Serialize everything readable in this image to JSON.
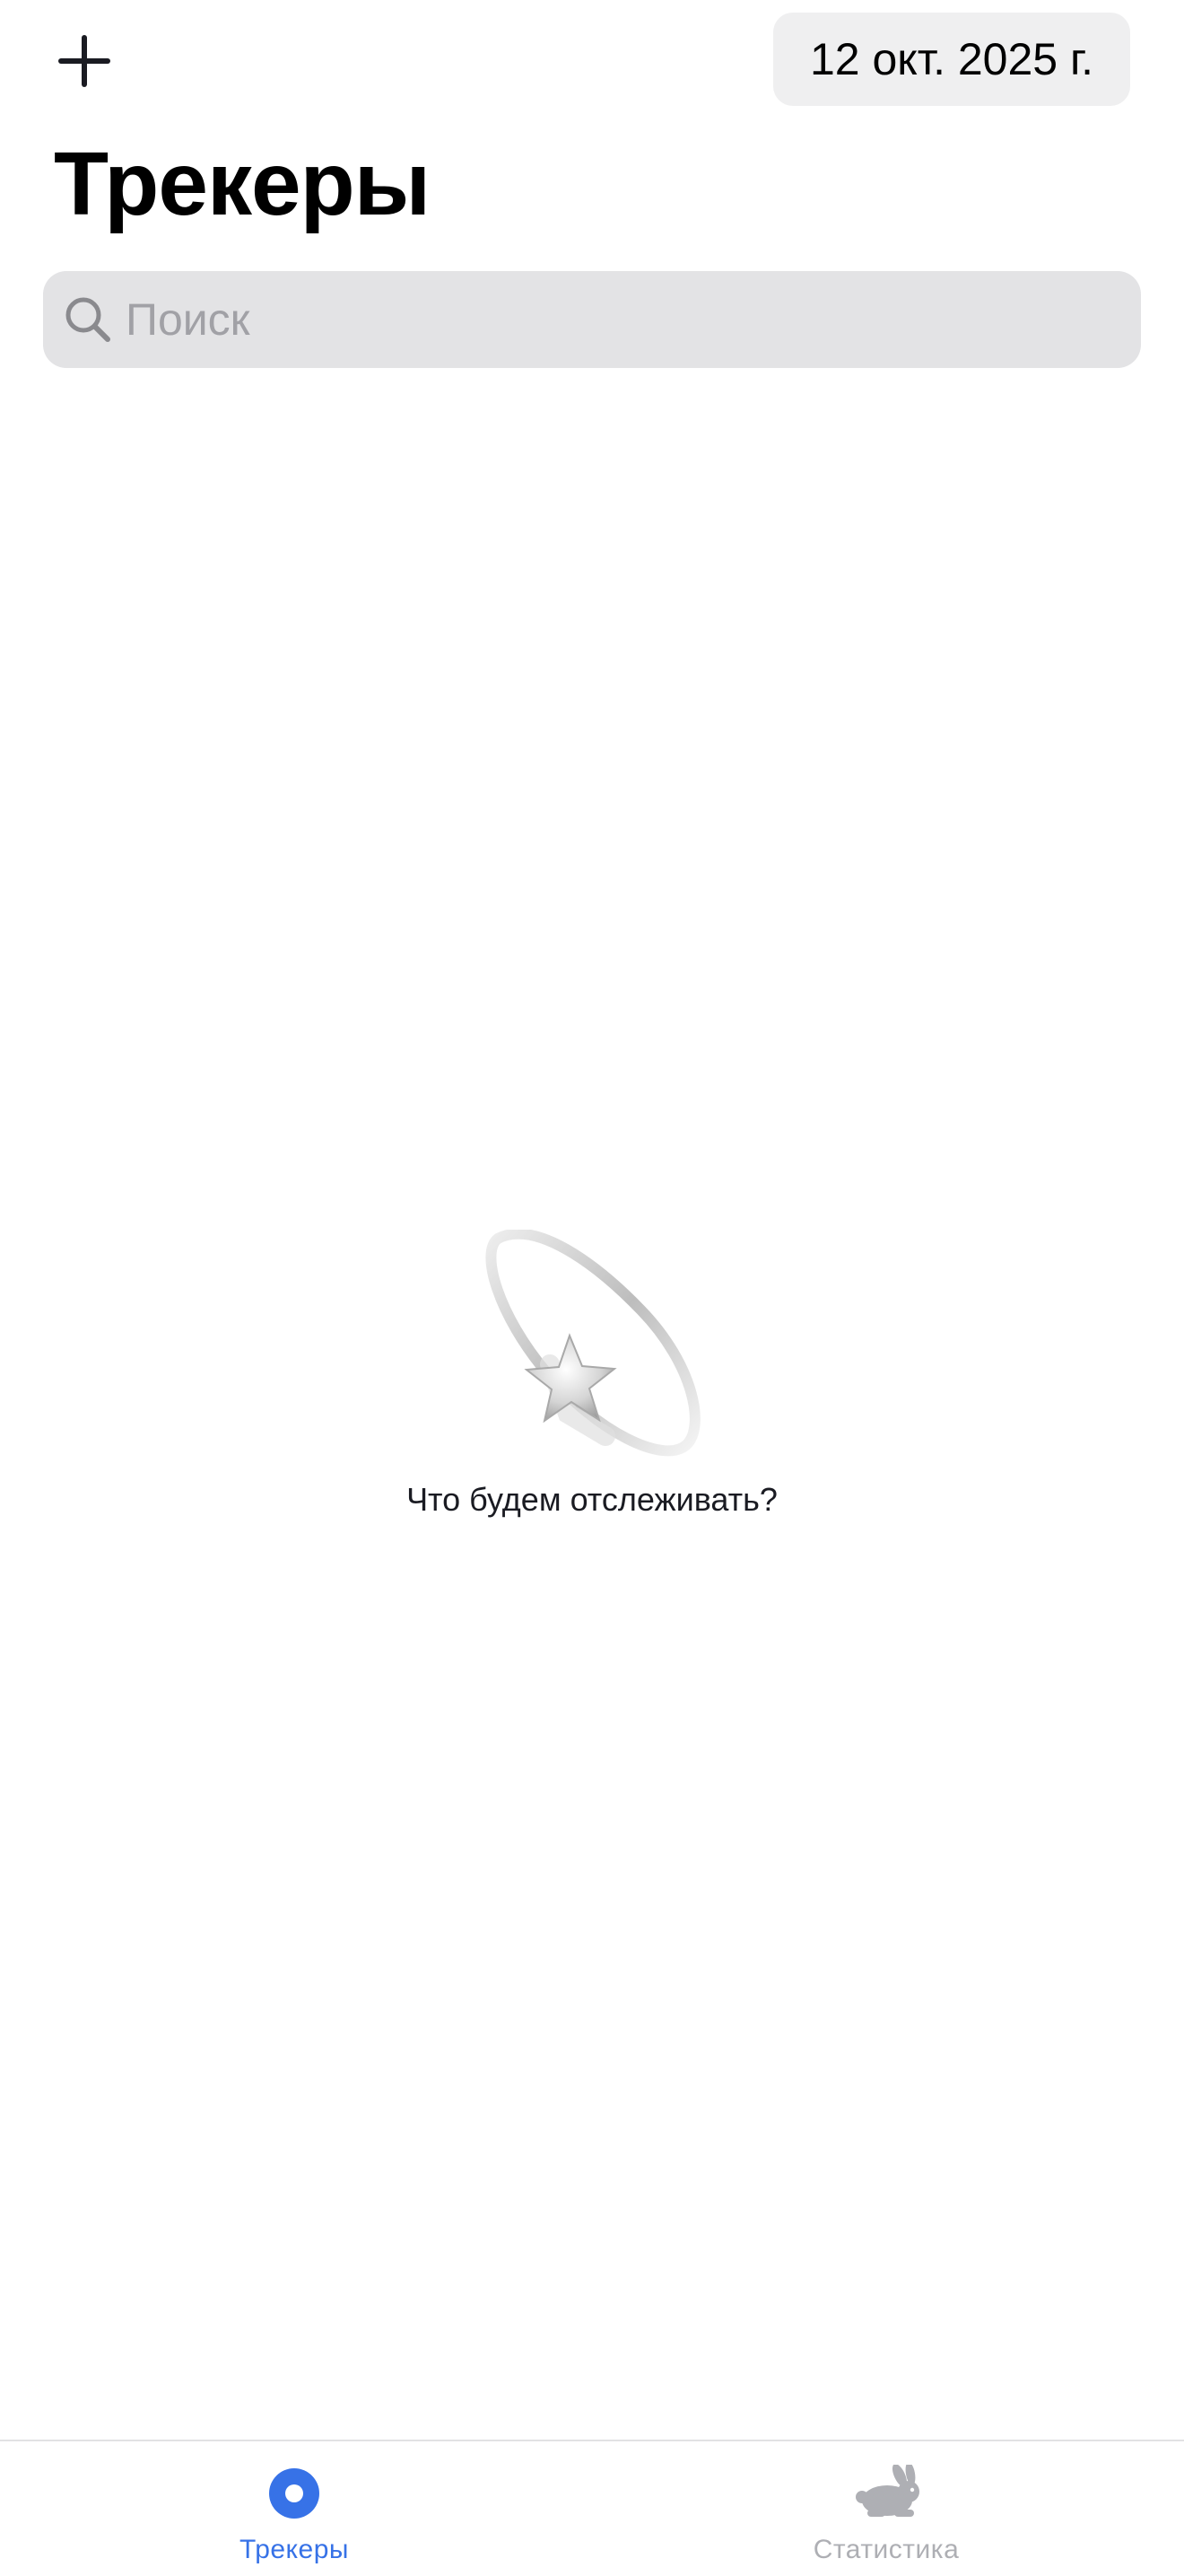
{
  "header": {
    "add_icon": "plus-icon",
    "date_label": "12 окт. 2025 г.",
    "title": "Трекеры"
  },
  "search": {
    "icon": "magnifying-glass-icon",
    "placeholder": "Поиск",
    "value": ""
  },
  "empty_state": {
    "illustration": "shooting-star-icon",
    "message": "Что будем отслеживать?"
  },
  "tab_bar": {
    "tabs": [
      {
        "label": "Трекеры",
        "icon": "record-circle-icon",
        "active": true
      },
      {
        "label": "Статистика",
        "icon": "hare-icon",
        "active": false
      }
    ]
  },
  "colors": {
    "accent": "#3772E7",
    "tab_active": "#3772E7",
    "tab_inactive": "#AEAFB4",
    "search_background": "#E3E3E5",
    "date_background": "#EFEFF0",
    "placeholder": "#A1A1A6",
    "text": "#1A1B22"
  }
}
